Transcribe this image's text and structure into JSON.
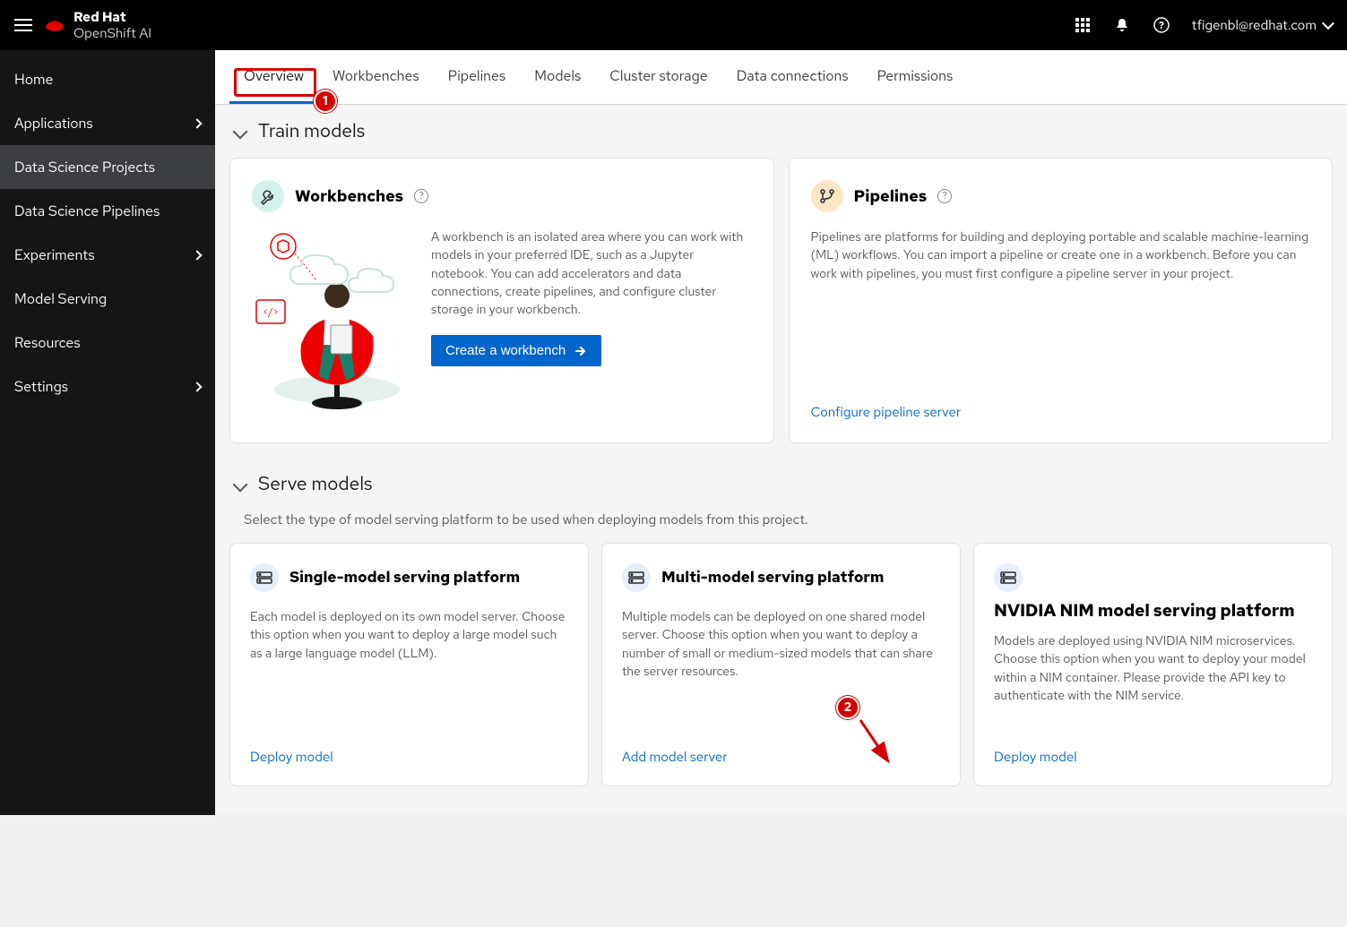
{
  "brand": {
    "line1": "Red Hat",
    "line2": "OpenShift AI"
  },
  "user": "tfigenbl@redhat.com",
  "sidebar": {
    "items": [
      {
        "label": "Home",
        "expandable": false
      },
      {
        "label": "Applications",
        "expandable": true
      },
      {
        "label": "Data Science Projects",
        "expandable": false
      },
      {
        "label": "Data Science Pipelines",
        "expandable": false
      },
      {
        "label": "Experiments",
        "expandable": true
      },
      {
        "label": "Model Serving",
        "expandable": false
      },
      {
        "label": "Resources",
        "expandable": false
      },
      {
        "label": "Settings",
        "expandable": true
      }
    ]
  },
  "tabs": [
    "Overview",
    "Workbenches",
    "Pipelines",
    "Models",
    "Cluster storage",
    "Data connections",
    "Permissions"
  ],
  "train_section": {
    "title": "Train models"
  },
  "workbenches": {
    "title": "Workbenches",
    "desc": "A workbench is an isolated area where you can work with models in your preferred IDE, such as a Jupyter notebook. You can add accelerators and data connections, create pipelines, and configure cluster storage in your workbench.",
    "cta": "Create a workbench"
  },
  "pipelines": {
    "title": "Pipelines",
    "desc": "Pipelines are platforms for building and deploying portable and scalable machine-learning (ML) workflows. You can import a pipeline or create one in a workbench. Before you can work with pipelines, you must first configure a pipeline server in your project.",
    "cta": "Configure pipeline server"
  },
  "serve_section": {
    "title": "Serve models",
    "desc": "Select the type of model serving platform to be used when deploying models from this project."
  },
  "serve_cards": [
    {
      "title": "Single-model serving platform",
      "desc": "Each model is deployed on its own model server. Choose this option when you want to deploy a large model such as a large language model (LLM).",
      "cta": "Deploy model"
    },
    {
      "title": "Multi-model serving platform",
      "desc": "Multiple models can be deployed on one shared model server. Choose this option when you want to deploy a number of small or medium-sized models that can share the server resources.",
      "cta": "Add model server"
    },
    {
      "title": "NVIDIA NIM model serving platform",
      "desc": "Models are deployed using NVIDIA NIM microservices. Choose this option when you want to deploy your model within a NIM container. Please provide the API key to authenticate with the NIM service.",
      "cta": "Deploy model",
      "title_large": true
    }
  ],
  "annotations": {
    "badge1": "1",
    "badge2": "2"
  }
}
